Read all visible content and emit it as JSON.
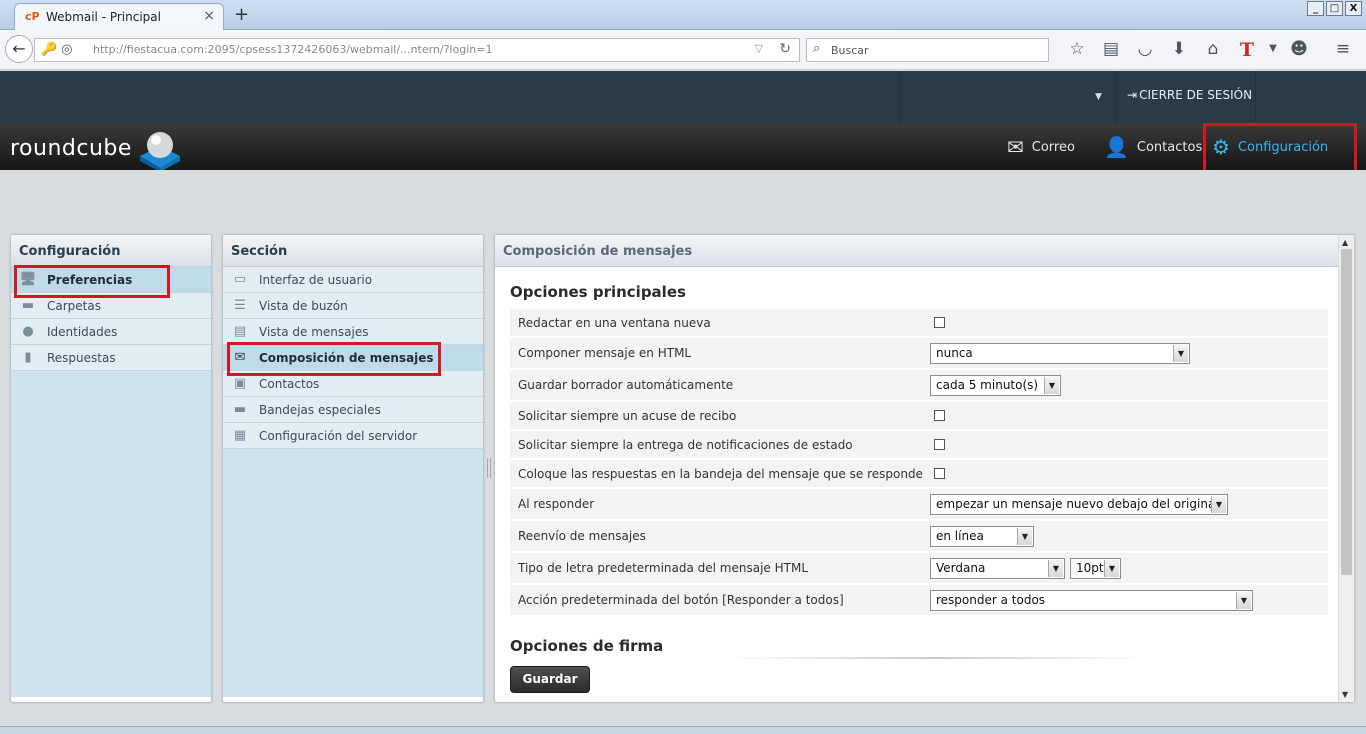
{
  "browser": {
    "tab_title": "Webmail - Principal",
    "tab_icon": "cP",
    "url_visible": "http://fiestacua.com:2095/cpsess1372426063/webmail/...ntern/?login=1",
    "search_placeholder": "Buscar",
    "new_tab_symbol": "+",
    "close_tab_symbol": "×",
    "window_buttons": [
      "_",
      "□",
      "X"
    ]
  },
  "topbar": {
    "logout_label": "CIERRE DE SESIÓN"
  },
  "header": {
    "logo_text": "roundcube",
    "nav": {
      "correo": "Correo",
      "contactos": "Contactos",
      "configuracion": "Configuración"
    }
  },
  "left_panel": {
    "title": "Configuración",
    "items": [
      {
        "label": "Preferencias",
        "icon": "monitor-icon"
      },
      {
        "label": "Carpetas",
        "icon": "folder-icon"
      },
      {
        "label": "Identidades",
        "icon": "person-icon"
      },
      {
        "label": "Respuestas",
        "icon": "document-icon"
      }
    ]
  },
  "middle_panel": {
    "title": "Sección",
    "items": [
      {
        "label": "Interfaz de usuario",
        "icon": "monitor-icon"
      },
      {
        "label": "Vista de buzón",
        "icon": "list-icon"
      },
      {
        "label": "Vista de mensajes",
        "icon": "message-view-icon"
      },
      {
        "label": "Composición de mensajes",
        "icon": "compose-icon"
      },
      {
        "label": "Contactos",
        "icon": "contacts-icon"
      },
      {
        "label": "Bandejas especiales",
        "icon": "folder-icon"
      },
      {
        "label": "Configuración del servidor",
        "icon": "server-icon"
      }
    ]
  },
  "main_panel": {
    "title": "Composición de mensajes",
    "section_main": "Opciones principales",
    "section_signature": "Opciones de firma",
    "save_label": "Guardar",
    "rows": [
      {
        "label": "Redactar en una ventana nueva",
        "type": "checkbox",
        "checked": false
      },
      {
        "label": "Componer mensaje en HTML",
        "type": "select",
        "value": "nunca"
      },
      {
        "label": "Guardar borrador automáticamente",
        "type": "select",
        "value": "cada 5 minuto(s)"
      },
      {
        "label": "Solicitar siempre un acuse de recibo",
        "type": "checkbox",
        "checked": false
      },
      {
        "label": "Solicitar siempre la entrega de notificaciones de estado",
        "type": "checkbox",
        "checked": false
      },
      {
        "label": "Coloque las respuestas en la bandeja del mensaje que se responde",
        "type": "checkbox",
        "checked": false
      },
      {
        "label": "Al responder",
        "type": "select",
        "value": "empezar un mensaje nuevo debajo del original"
      },
      {
        "label": "Reenvío de mensajes",
        "type": "select",
        "value": "en línea"
      },
      {
        "label": "Tipo de letra predeterminada del mensaje HTML",
        "type": "select2",
        "value": "Verdana",
        "value2": "10pt"
      },
      {
        "label": "Acción predeterminada del botón [Responder a todos]",
        "type": "select",
        "value": "responder a todos"
      }
    ]
  },
  "colors": {
    "accent": "#36b6ee",
    "highlight_border": "#d3191f",
    "topbar_bg": "#2c3a47"
  }
}
